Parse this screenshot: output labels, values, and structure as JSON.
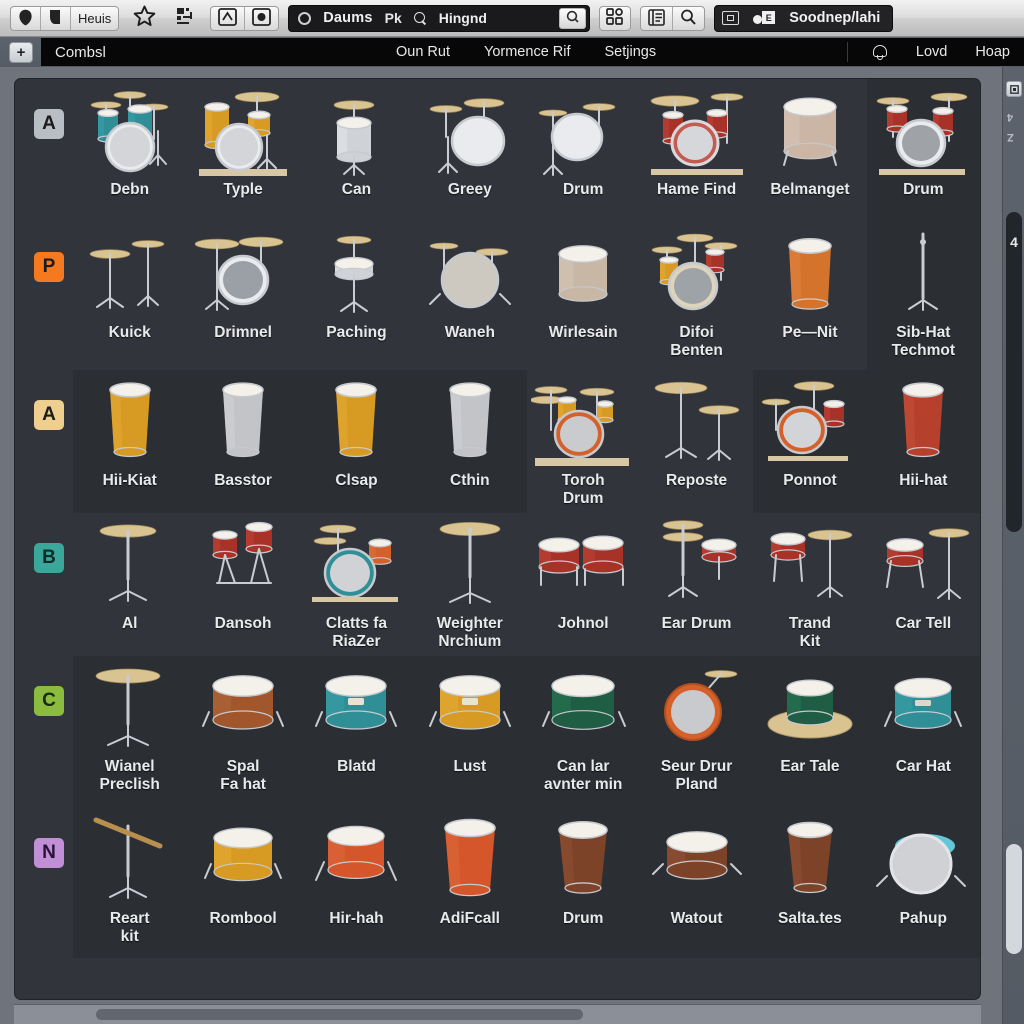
{
  "toolbar": {
    "back_icon": "back-shape-icon",
    "forward_icon": "forward-shape-icon",
    "library_label": "Heuis",
    "star_icon": "star-icon",
    "tools_icon": "tools-icon",
    "view_icon": "view-box-icon",
    "media_icon": "media-box-icon",
    "search": {
      "circle_icon": "knob-icon",
      "category": "Daums",
      "category_suffix": "Pk",
      "magnifier_icon": "search-icon",
      "value": "Hingnd",
      "end_button_icon": "search-go-icon"
    },
    "panel_icon_1": "layout-panels-icon",
    "panel_icon_2": "list-view-icon",
    "panel_icon_3": "tag-icon",
    "status": {
      "frame_icon": "frame-icon",
      "marker_icon": "marker-e-icon",
      "marker_letter": "E",
      "text": "Soodnep/lahi"
    }
  },
  "menustrip": {
    "add_button": "+",
    "left_title": "Combsl",
    "center_items": [
      "Oun Rut",
      "Yormence Rif",
      "Setjings"
    ],
    "bell_icon": "bell-icon",
    "right_items": [
      "Lovd",
      "Hoap"
    ]
  },
  "rail": {
    "top_icon": "panel-toggle-icon",
    "marks": [
      "4",
      "Z"
    ],
    "scroll_number": "4"
  },
  "browser": {
    "rows": [
      {
        "badge": {
          "letter": "A",
          "bg": "#b9bdc4",
          "fg": "#1b1b1b"
        },
        "items": [
          {
            "label": "Debn",
            "art": "kit-teal",
            "tile": false
          },
          {
            "label": "Typle",
            "art": "kit-gold",
            "tile": false
          },
          {
            "label": "Can",
            "art": "floor-silver",
            "tile": false
          },
          {
            "label": "Greey",
            "art": "bass-silver",
            "tile": false
          },
          {
            "label": "Drum",
            "art": "bass-plain",
            "tile": false
          },
          {
            "label": "Hame Find",
            "art": "kit-red",
            "tile": false
          },
          {
            "label": "Belmanget",
            "art": "floor-tan",
            "tile": false
          },
          {
            "label": "Drum",
            "art": "kit-red2",
            "tile": true
          }
        ]
      },
      {
        "badge": {
          "letter": "P",
          "bg": "#f4791f",
          "fg": "#1b1b1b"
        },
        "items": [
          {
            "label": "Kuick",
            "art": "hats-pair",
            "tile": false
          },
          {
            "label": "Drimnel",
            "art": "bass-cyms",
            "tile": false
          },
          {
            "label": "Paching",
            "art": "hat-snare",
            "tile": false
          },
          {
            "label": "Waneh",
            "art": "bass-big",
            "tile": false
          },
          {
            "label": "Wirlesain",
            "art": "tom-tan",
            "tile": false
          },
          {
            "label": "Difoi\nBenten",
            "art": "kit-cream",
            "tile": false
          },
          {
            "label": "Pe—Nit",
            "art": "conga-orange",
            "tile": false
          },
          {
            "label": "Sib-Hat\nTechmot",
            "art": "stand-tall",
            "tile": true
          }
        ]
      },
      {
        "badge": {
          "letter": "A",
          "bg": "#eecf8f",
          "fg": "#1b1b1b"
        },
        "items": [
          {
            "label": "Hii-Kiat",
            "art": "conga-gold",
            "tile": true
          },
          {
            "label": "Basstor",
            "art": "conga-grey",
            "tile": true
          },
          {
            "label": "Clsap",
            "art": "conga-gold",
            "tile": true
          },
          {
            "label": "Cthin",
            "art": "conga-grey",
            "tile": true
          },
          {
            "label": "Toroh\nDrum",
            "art": "kit-orange",
            "tile": false
          },
          {
            "label": "Reposte",
            "art": "rides-two",
            "tile": false
          },
          {
            "label": "Ponnot",
            "art": "kit-orange2",
            "tile": true
          },
          {
            "label": "Hii-hat",
            "art": "conga-red",
            "tile": true
          }
        ]
      },
      {
        "badge": {
          "letter": "B",
          "bg": "#3aa79a",
          "fg": "#0f2a27"
        },
        "items": [
          {
            "label": "Al",
            "art": "ride-stand",
            "tile": false
          },
          {
            "label": "Dansoh",
            "art": "toms-two",
            "tile": false
          },
          {
            "label": "Clatts fa\nRiaZer",
            "art": "kit-cyan",
            "tile": false
          },
          {
            "label": "Weighter\nNrchium",
            "art": "crash-stand",
            "tile": false
          },
          {
            "label": "Johnol",
            "art": "timbales",
            "tile": false
          },
          {
            "label": "Ear Drum",
            "art": "hat-snare2",
            "tile": false
          },
          {
            "label": "Trand\nKit",
            "art": "snare-ride",
            "tile": false
          },
          {
            "label": "Car Tell",
            "art": "snare-ride2",
            "tile": false
          }
        ]
      },
      {
        "badge": {
          "letter": "C",
          "bg": "#8cbc3f",
          "fg": "#1b2a0c"
        },
        "items": [
          {
            "label": "Wianel\nPreclish",
            "art": "ride-stand2",
            "tile": true
          },
          {
            "label": "Spal\nFa hat",
            "art": "snare-brown",
            "tile": true
          },
          {
            "label": "Blatd",
            "art": "snare-teal",
            "tile": true
          },
          {
            "label": "Lust",
            "art": "snare-gold",
            "tile": true
          },
          {
            "label": "Can lar\navnter min",
            "art": "snare-green",
            "tile": true
          },
          {
            "label": "Seur Drur\nPland",
            "art": "frame-orange",
            "tile": true
          },
          {
            "label": "Ear Tale",
            "art": "snare-hat",
            "tile": true
          },
          {
            "label": "Car Hat",
            "art": "snare-teal2",
            "tile": true
          }
        ]
      },
      {
        "badge": {
          "letter": "N",
          "bg": "#c08fd6",
          "fg": "#2a133a"
        },
        "items": [
          {
            "label": "Reart\nkit",
            "art": "stick-stand",
            "tile": true
          },
          {
            "label": "Rombool",
            "art": "snare-gold2",
            "tile": true
          },
          {
            "label": "Hir-hah",
            "art": "snare-orange",
            "tile": true
          },
          {
            "label": "AdiFcall",
            "art": "conga-orange2",
            "tile": true
          },
          {
            "label": "Drum",
            "art": "conga-brown",
            "tile": true
          },
          {
            "label": "Watout",
            "art": "snare-brown2",
            "tile": true
          },
          {
            "label": "Salta.tes",
            "art": "conga-brown2",
            "tile": true
          },
          {
            "label": "Pahup",
            "art": "bass-front",
            "tile": true
          }
        ]
      }
    ]
  }
}
